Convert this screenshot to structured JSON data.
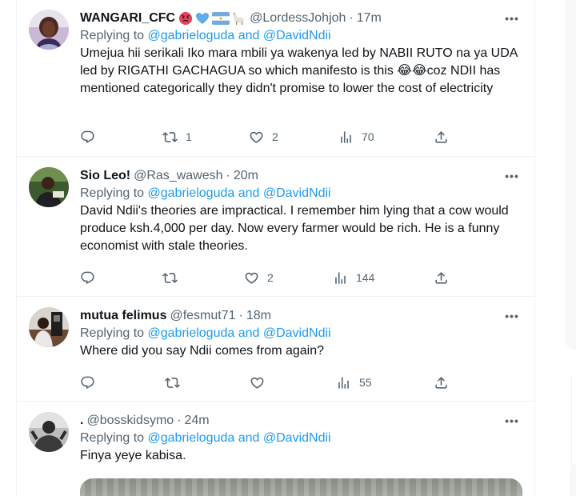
{
  "tweets": [
    {
      "name": "WANGARI_CFC",
      "emoji_names": [
        "angry-face",
        "blue-heart",
        "argentina-flag",
        "goat"
      ],
      "handle": "@LordessJohjoh",
      "time": "17m",
      "replying_prefix": "Replying to ",
      "replying_user1": "@gabrieloguda",
      "replying_and": " and ",
      "replying_user2": "@DavidNdii",
      "text_before": "Umejua hii serikali Iko mara mbili ya wakenya led by NABII RUTO na ya UDA led by RIGATHI GACHAGUA so which manifesto is this ",
      "text_emoji": "😂😂",
      "text_after": "coz NDII has mentioned categorically they didn't promise to lower the cost of electricity",
      "retweets": "1",
      "likes": "2",
      "views": "70"
    },
    {
      "name": "Sio Leo!",
      "handle": "@Ras_wawesh",
      "time": "20m",
      "replying_prefix": "Replying to ",
      "replying_user1": "@gabrieloguda",
      "replying_and": " and ",
      "replying_user2": "@DavidNdii",
      "text": "David Ndii's theories are impractical. I remember him lying that a cow would produce ksh.4,000 per day. Now every farmer would be rich. He is a funny economist with stale theories.",
      "retweets": "",
      "likes": "2",
      "views": "144"
    },
    {
      "name": "mutua felimus",
      "handle": "@fesmut71",
      "time": "18m",
      "replying_prefix": "Replying to ",
      "replying_user1": "@gabrieloguda",
      "replying_and": " and ",
      "replying_user2": "@DavidNdii",
      "text": "Where did you  say Ndii comes from again?",
      "retweets": "",
      "likes": "",
      "views": "55"
    },
    {
      "name": ".",
      "handle": "@bosskidsymo",
      "time": "24m",
      "replying_prefix": "Replying to ",
      "replying_user1": "@gabrieloguda",
      "replying_and": " and ",
      "replying_user2": "@DavidNdii",
      "text": "Finya yeye kabisa."
    }
  ],
  "separator": "·",
  "more_label": "•••",
  "icons": [
    "reply-icon",
    "retweet-icon",
    "like-icon",
    "views-icon",
    "share-icon",
    "more-icon"
  ],
  "colors": {
    "link": "#1d9bf0",
    "secondary": "#536471",
    "text": "#0f1419",
    "border": "#eff3f4"
  }
}
